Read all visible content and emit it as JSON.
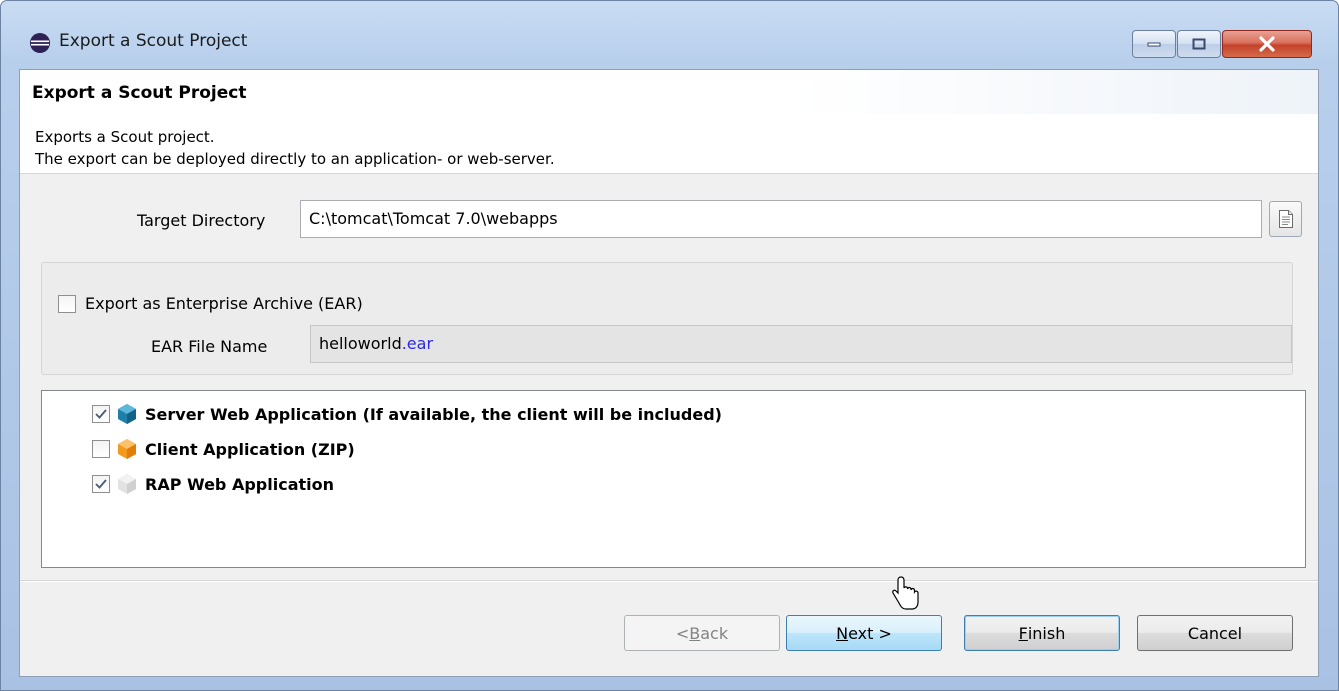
{
  "window": {
    "title": "Export a Scout Project",
    "controls": {
      "minimize": "minimize",
      "maximize": "maximize",
      "close": "close"
    }
  },
  "header": {
    "title": "Export a Scout Project",
    "description_line1": "Exports a Scout project.",
    "description_line2": "The export can be deployed directly to an application- or web-server."
  },
  "target": {
    "label": "Target Directory",
    "value": "C:\\tomcat\\Tomcat 7.0\\webapps"
  },
  "ear": {
    "checkbox_label": "Export as Enterprise Archive (EAR)",
    "checked": false,
    "file_name_label": "EAR File Name",
    "file_name_base": "helloworld",
    "file_name_ext": ".ear"
  },
  "modules": [
    {
      "label": "Server Web Application (If available, the client will be included)",
      "checked": true,
      "icon": "server-cube-icon",
      "color": "#1f7fa8"
    },
    {
      "label": "Client Application (ZIP)",
      "checked": false,
      "icon": "client-cube-icon",
      "color": "#f39a1e"
    },
    {
      "label": "RAP Web Application",
      "checked": true,
      "icon": "rap-cube-icon",
      "color": "#dcdcdc"
    }
  ],
  "buttons": {
    "back_prefix": "< ",
    "back_mnemonic": "B",
    "back_rest": "ack",
    "next_mnemonic": "N",
    "next_rest": "ext >",
    "finish_mnemonic": "F",
    "finish_rest": "inish",
    "cancel": "Cancel"
  }
}
